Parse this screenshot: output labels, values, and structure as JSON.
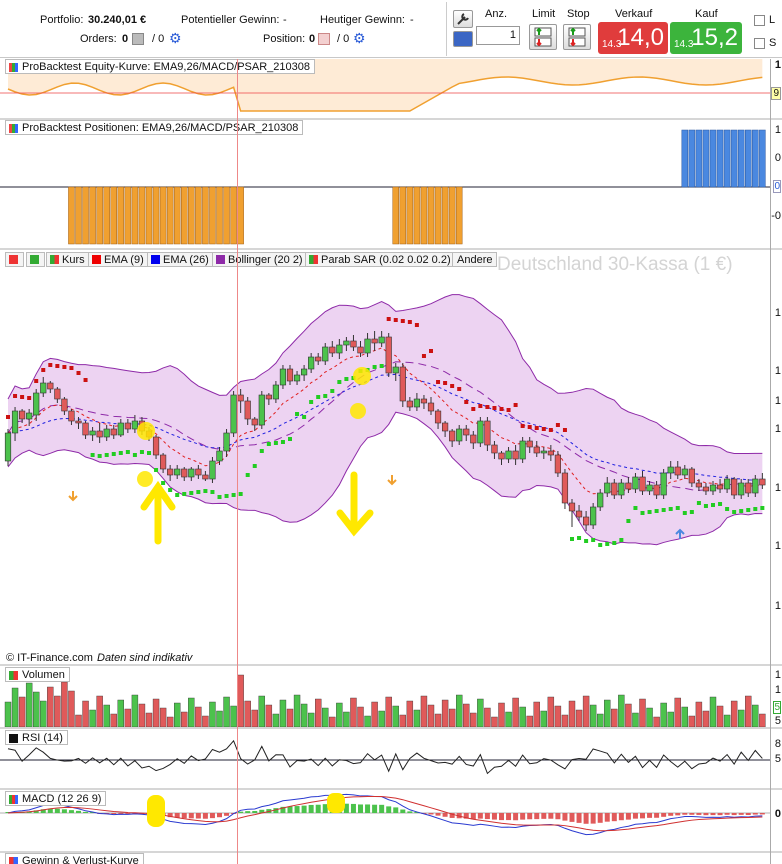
{
  "header": {
    "portfolio_label": "Portfolio:",
    "portfolio_value": "30.240,01 €",
    "orders_label": "Orders:",
    "orders_count": "0",
    "orders_total": "/ 0",
    "potential_gain_label": "Potentieller Gewinn:",
    "potential_gain_value": "-",
    "position_label": "Position:",
    "position_value": "0",
    "position_total": "/ 0",
    "today_gain_label": "Heutiger Gewinn:",
    "today_gain_value": "-"
  },
  "order_bar": {
    "quantity_label": "Anz.",
    "quantity_value": "1",
    "limit_label": "Limit",
    "stop_label": "Stop",
    "sell_label": "Verkauf",
    "sell_small": "14.3",
    "sell_large": "14,0",
    "buy_label": "Kauf",
    "buy_small": "14.3",
    "buy_large": "15,2",
    "check_l": "L",
    "check_s": "S",
    "sell_color": "#e03c3c",
    "buy_color": "#3cb43c"
  },
  "panels": {
    "equity_title": "ProBacktest Equity-Kurve: EMA9,26/MACD/PSAR_210308",
    "equity_axis": [
      "1",
      "9"
    ],
    "positions_title": "ProBacktest Positionen: EMA9,26/MACD/PSAR_210308",
    "positions_axis": [
      "1",
      "0",
      "0",
      "-0"
    ],
    "volume_title": "Volumen",
    "volume_axis": [
      "1",
      "1",
      "5",
      "5"
    ],
    "rsi_title": "RSI (14)",
    "rsi_axis": [
      "8",
      "5"
    ],
    "macd_title": "MACD (12 26 9)",
    "macd_axis": [
      "0"
    ],
    "pl_title": "Gewinn & Verlust-Kurve"
  },
  "legend": {
    "kurs": "Kurs",
    "ema9": "EMA (9)",
    "ema26": "EMA (26)",
    "bollinger": "Bollinger (20 2)",
    "psar": "Parab SAR (0.02 0.02 0.2)",
    "other": "Andere"
  },
  "main_chart": {
    "instrument": "Deutschland 30-Kassa (1 €)",
    "copyright": "© IT-Finance.com",
    "disclaimer": "Daten sind indikativ",
    "price_axis": [
      "1",
      "1",
      "1",
      "1",
      "1",
      "1",
      "1",
      "1",
      "1"
    ],
    "colors": {
      "up": "#4cc24c",
      "down": "#e05a5a",
      "band": "#e8c8ef",
      "band_line": "#8e2aa8",
      "psar_up": "#22cc22",
      "psar_down": "#cc1111",
      "ema_fast": "#e02020",
      "ema_slow": "#2020e0",
      "highlight": "#ffe800"
    }
  },
  "chart_data": {
    "type": "candlestick",
    "title": "Deutschland 30-Kassa (1 €)",
    "candles": [
      [
        0,
        20,
        48,
        15,
        52
      ],
      [
        1,
        48,
        70,
        40,
        74
      ],
      [
        2,
        70,
        62,
        58,
        72
      ],
      [
        3,
        62,
        68,
        55,
        72
      ],
      [
        4,
        66,
        88,
        60,
        92
      ],
      [
        5,
        88,
        98,
        84,
        104
      ],
      [
        6,
        98,
        92,
        88,
        100
      ],
      [
        7,
        92,
        82,
        78,
        94
      ],
      [
        8,
        82,
        70,
        66,
        84
      ],
      [
        9,
        70,
        60,
        56,
        72
      ],
      [
        10,
        60,
        58,
        52,
        64
      ],
      [
        11,
        58,
        46,
        42,
        60
      ],
      [
        12,
        46,
        50,
        40,
        54
      ],
      [
        13,
        50,
        44,
        38,
        58
      ],
      [
        14,
        44,
        52,
        40,
        56
      ],
      [
        15,
        52,
        46,
        42,
        56
      ],
      [
        16,
        46,
        58,
        44,
        62
      ],
      [
        17,
        58,
        52,
        48,
        62
      ],
      [
        18,
        52,
        60,
        48,
        66
      ],
      [
        19,
        60,
        50,
        46,
        64
      ],
      [
        20,
        50,
        44,
        40,
        54
      ],
      [
        21,
        44,
        26,
        22,
        46
      ],
      [
        22,
        26,
        12,
        8,
        28
      ],
      [
        23,
        12,
        6,
        0,
        16
      ],
      [
        24,
        6,
        12,
        2,
        16
      ],
      [
        25,
        12,
        4,
        0,
        14
      ],
      [
        26,
        4,
        12,
        0,
        14
      ],
      [
        27,
        12,
        6,
        2,
        16
      ],
      [
        28,
        6,
        2,
        0,
        10
      ],
      [
        29,
        2,
        20,
        -2,
        24
      ],
      [
        30,
        20,
        30,
        16,
        34
      ],
      [
        31,
        30,
        48,
        24,
        52
      ],
      [
        32,
        48,
        86,
        44,
        90
      ],
      [
        33,
        86,
        80,
        68,
        92
      ],
      [
        34,
        80,
        62,
        56,
        84
      ],
      [
        35,
        62,
        56,
        50,
        64
      ],
      [
        36,
        56,
        86,
        52,
        90
      ],
      [
        37,
        86,
        82,
        76,
        88
      ],
      [
        38,
        82,
        96,
        78,
        100
      ],
      [
        39,
        96,
        112,
        92,
        116
      ],
      [
        40,
        112,
        100,
        96,
        116
      ],
      [
        41,
        100,
        106,
        96,
        110
      ],
      [
        42,
        106,
        112,
        100,
        116
      ],
      [
        43,
        112,
        124,
        108,
        128
      ],
      [
        44,
        124,
        120,
        116,
        128
      ],
      [
        45,
        120,
        134,
        116,
        138
      ],
      [
        46,
        134,
        128,
        124,
        140
      ],
      [
        47,
        128,
        136,
        122,
        142
      ],
      [
        48,
        136,
        140,
        130,
        144
      ],
      [
        49,
        140,
        134,
        130,
        146
      ],
      [
        50,
        134,
        128,
        124,
        140
      ],
      [
        51,
        128,
        142,
        124,
        148
      ],
      [
        52,
        142,
        138,
        130,
        150
      ],
      [
        53,
        138,
        144,
        134,
        150
      ],
      [
        54,
        144,
        108,
        104,
        148
      ],
      [
        55,
        108,
        114,
        100,
        118
      ],
      [
        56,
        114,
        80,
        74,
        118
      ],
      [
        57,
        80,
        74,
        70,
        84
      ],
      [
        58,
        74,
        82,
        70,
        88
      ],
      [
        59,
        82,
        78,
        72,
        86
      ],
      [
        60,
        78,
        70,
        66,
        84
      ],
      [
        61,
        70,
        58,
        52,
        72
      ],
      [
        62,
        58,
        50,
        44,
        60
      ],
      [
        63,
        50,
        40,
        34,
        52
      ],
      [
        64,
        40,
        52,
        36,
        56
      ],
      [
        65,
        52,
        46,
        40,
        56
      ],
      [
        66,
        46,
        38,
        32,
        50
      ],
      [
        67,
        38,
        60,
        34,
        64
      ],
      [
        68,
        60,
        36,
        30,
        64
      ],
      [
        69,
        36,
        28,
        22,
        40
      ],
      [
        70,
        28,
        22,
        16,
        30
      ],
      [
        71,
        22,
        30,
        18,
        34
      ],
      [
        72,
        30,
        22,
        16,
        36
      ],
      [
        73,
        22,
        40,
        18,
        44
      ],
      [
        74,
        40,
        34,
        28,
        44
      ],
      [
        75,
        34,
        28,
        24,
        40
      ],
      [
        76,
        28,
        30,
        22,
        34
      ],
      [
        77,
        30,
        26,
        20,
        36
      ],
      [
        78,
        26,
        8,
        4,
        30
      ],
      [
        79,
        8,
        -22,
        -28,
        12
      ],
      [
        80,
        -22,
        -30,
        -46,
        -18
      ],
      [
        81,
        -30,
        -36,
        -40,
        -24
      ],
      [
        82,
        -36,
        -44,
        -50,
        -30
      ],
      [
        83,
        -44,
        -26,
        -48,
        -22
      ],
      [
        84,
        -26,
        -12,
        -30,
        -8
      ],
      [
        85,
        -12,
        -2,
        -16,
        4
      ],
      [
        86,
        -2,
        -14,
        -18,
        2
      ],
      [
        87,
        -14,
        -2,
        -18,
        2
      ],
      [
        88,
        -2,
        -8,
        -12,
        4
      ],
      [
        89,
        -8,
        4,
        -12,
        8
      ],
      [
        90,
        4,
        -10,
        -14,
        10
      ],
      [
        91,
        -10,
        -4,
        -14,
        0
      ],
      [
        92,
        -4,
        -14,
        -18,
        0
      ],
      [
        93,
        -14,
        8,
        -18,
        12
      ],
      [
        94,
        8,
        14,
        2,
        20
      ],
      [
        95,
        14,
        6,
        2,
        20
      ],
      [
        96,
        6,
        12,
        2,
        16
      ],
      [
        97,
        12,
        -2,
        -6,
        14
      ],
      [
        98,
        -2,
        -6,
        -10,
        2
      ],
      [
        99,
        -6,
        -10,
        -14,
        -2
      ],
      [
        100,
        -10,
        -4,
        -14,
        0
      ],
      [
        101,
        -4,
        -8,
        -12,
        2
      ],
      [
        102,
        -8,
        2,
        -12,
        6
      ],
      [
        103,
        2,
        -14,
        -18,
        4
      ],
      [
        104,
        -14,
        -2,
        -18,
        2
      ],
      [
        105,
        -2,
        -12,
        -16,
        2
      ],
      [
        106,
        -12,
        2,
        -16,
        6
      ],
      [
        107,
        2,
        -4,
        -8,
        8
      ]
    ]
  }
}
